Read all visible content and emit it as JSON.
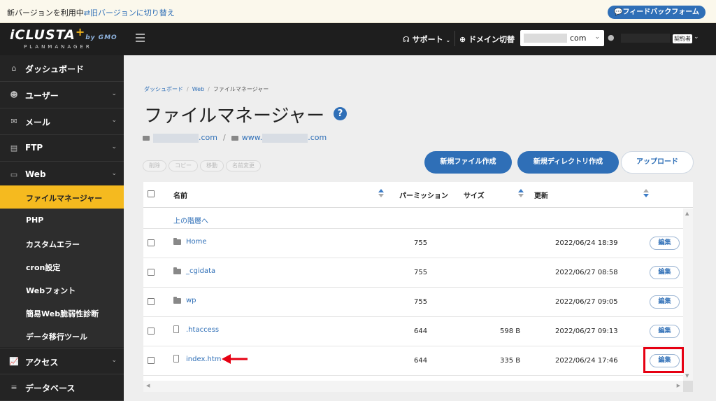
{
  "notice": {
    "text": "新バージョンを利用中",
    "link": "旧バージョンに切り替え",
    "feedback": "フィードバックフォーム"
  },
  "header": {
    "logo": "iCLUSTA",
    "logo_gmo": "by GMO",
    "logo_sub": "PLANMANAGER",
    "support": "サポート",
    "domain_switch": "ドメイン切替",
    "domain_value": "com",
    "user_badge": "契約者"
  },
  "sidebar": {
    "items": [
      {
        "label": "ダッシュボード",
        "icon": "home-icon",
        "caret": false
      },
      {
        "label": "ユーザー",
        "icon": "users-icon",
        "caret": true
      },
      {
        "label": "メール",
        "icon": "mail-icon",
        "caret": true
      },
      {
        "label": "FTP",
        "icon": "file-icon",
        "caret": true
      },
      {
        "label": "Web",
        "icon": "window-icon",
        "caret": true
      }
    ],
    "web_sub": [
      {
        "label": "ファイルマネージャー",
        "active": true
      },
      {
        "label": "PHP",
        "active": false
      },
      {
        "label": "カスタムエラー",
        "active": false
      },
      {
        "label": "cron設定",
        "active": false
      },
      {
        "label": "Webフォント",
        "active": false
      },
      {
        "label": "簡易Web脆弱性診断",
        "active": false
      },
      {
        "label": "データ移行ツール",
        "active": false
      }
    ],
    "bottom": [
      {
        "label": "アクセス",
        "icon": "chart-icon",
        "caret": true
      },
      {
        "label": "データベース",
        "icon": "database-icon",
        "caret": false
      }
    ]
  },
  "breadcrumb": [
    "ダッシュボード",
    "Web",
    "ファイルマネージャー"
  ],
  "page_title": "ファイルマネージャー",
  "path": {
    "domain1_suffix": ".com",
    "domain2_prefix": "www.",
    "domain2_suffix": ".com"
  },
  "ghost_buttons": [
    "削除",
    "コピー",
    "移動",
    "名前変更"
  ],
  "actions": {
    "new_file": "新規ファイル作成",
    "new_dir": "新規ディレクトリ作成",
    "upload": "アップロード"
  },
  "table": {
    "headers": {
      "name": "名前",
      "permission": "パーミッション",
      "size": "サイズ",
      "updated": "更新"
    },
    "parent_link": "上の階層へ",
    "edit_label": "編集",
    "rows": [
      {
        "type": "folder",
        "name": "Home",
        "perm": "755",
        "size": "",
        "date": "2022/06/24 18:39"
      },
      {
        "type": "folder",
        "name": "_cgidata",
        "perm": "755",
        "size": "",
        "date": "2022/06/27 08:58"
      },
      {
        "type": "folder",
        "name": "wp",
        "perm": "755",
        "size": "",
        "date": "2022/06/27 09:05"
      },
      {
        "type": "file",
        "name": ".htaccess",
        "perm": "644",
        "size": "598 B",
        "date": "2022/06/27 09:13"
      },
      {
        "type": "file",
        "name": "index.htm",
        "perm": "644",
        "size": "335 B",
        "date": "2022/06/24 17:46"
      }
    ]
  },
  "colors": {
    "accent": "#2f6fb7",
    "active_nav": "#f5ba1f",
    "highlight": "#e60012"
  }
}
